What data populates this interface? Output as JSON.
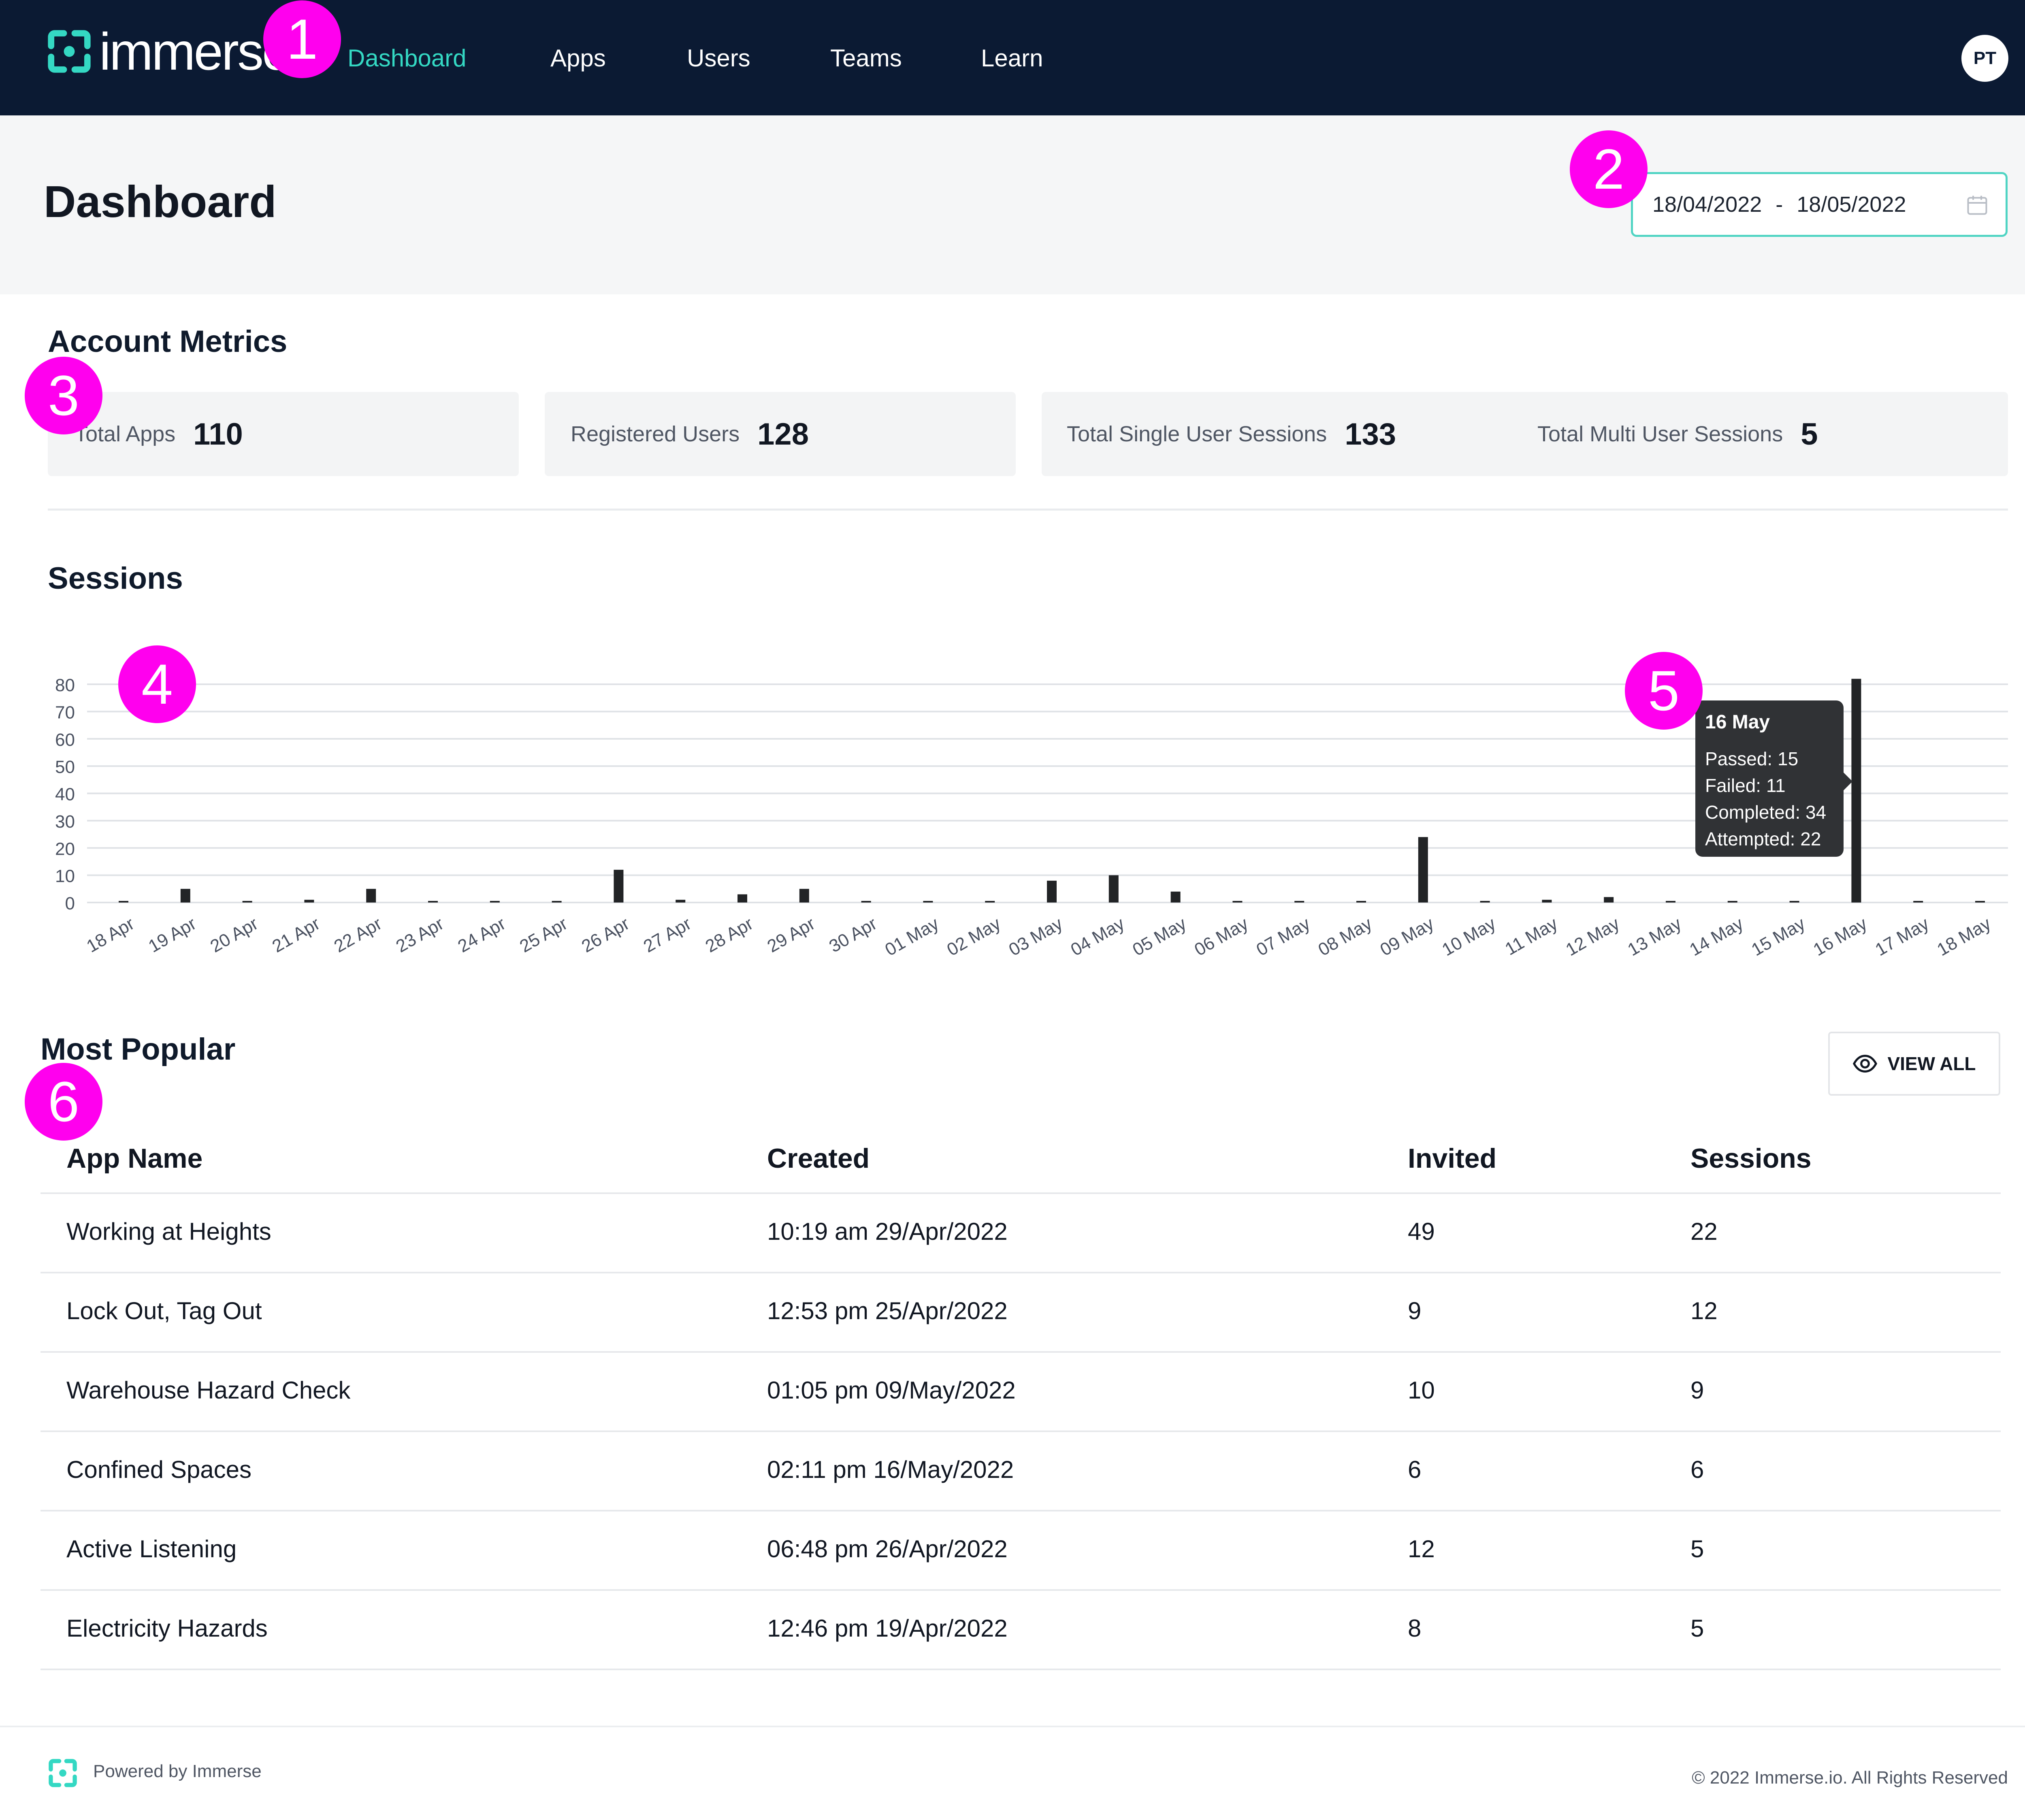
{
  "app": {
    "brand": "immerse"
  },
  "nav": {
    "items": [
      "Dashboard",
      "Apps",
      "Users",
      "Teams",
      "Learn"
    ],
    "active": "Dashboard",
    "avatar_initials": "PT"
  },
  "page": {
    "title": "Dashboard",
    "date_start": "18/04/2022",
    "date_sep": "-",
    "date_end": "18/05/2022"
  },
  "metrics": {
    "title": "Account Metrics",
    "total_apps_label": "Total Apps",
    "total_apps": "110",
    "registered_users_label": "Registered Users",
    "registered_users": "128",
    "single_sessions_label": "Total Single User Sessions",
    "single_sessions": "133",
    "multi_sessions_label": "Total Multi User Sessions",
    "multi_sessions": "5"
  },
  "sessions": {
    "title": "Sessions"
  },
  "chart_data": {
    "type": "bar",
    "title": "Sessions",
    "categories": [
      "18 Apr",
      "19 Apr",
      "20 Apr",
      "21 Apr",
      "22 Apr",
      "23 Apr",
      "24 Apr",
      "25 Apr",
      "26 Apr",
      "27 Apr",
      "28 Apr",
      "29 Apr",
      "30 Apr",
      "01 May",
      "02 May",
      "03 May",
      "04 May",
      "05 May",
      "06 May",
      "07 May",
      "08 May",
      "09 May",
      "10 May",
      "11 May",
      "12 May",
      "13 May",
      "14 May",
      "15 May",
      "16 May",
      "17 May",
      "18 May"
    ],
    "values": [
      0,
      5,
      0,
      1,
      5,
      0,
      0,
      0,
      12,
      1,
      3,
      5,
      0,
      0,
      0,
      8,
      10,
      4,
      0,
      0,
      0,
      24,
      0,
      1,
      2,
      0,
      0,
      0,
      82,
      0,
      0
    ],
    "ylim": [
      0,
      80
    ],
    "yticks": [
      0,
      10,
      20,
      30,
      40,
      50,
      60,
      70,
      80
    ],
    "grid": true,
    "bar_color": "#222426",
    "tooltip": {
      "date": "16 May",
      "lines": [
        "Passed: 15",
        "Failed: 11",
        "Completed: 34",
        "Attempted: 22"
      ]
    }
  },
  "popular": {
    "title": "Most Popular",
    "view_all": "VIEW ALL",
    "columns": [
      "App Name",
      "Created",
      "Invited",
      "Sessions"
    ],
    "rows": [
      [
        "Working at Heights",
        "10:19 am 29/Apr/2022",
        "49",
        "22"
      ],
      [
        "Lock Out, Tag Out",
        "12:53 pm 25/Apr/2022",
        "9",
        "12"
      ],
      [
        "Warehouse Hazard Check",
        "01:05 pm 09/May/2022",
        "10",
        "9"
      ],
      [
        "Confined Spaces",
        "02:11 pm 16/May/2022",
        "6",
        "6"
      ],
      [
        "Active Listening",
        "06:48 pm 26/Apr/2022",
        "12",
        "5"
      ],
      [
        "Electricity Hazards",
        "12:46 pm 19/Apr/2022",
        "8",
        "5"
      ]
    ]
  },
  "footer": {
    "powered": "Powered by Immerse",
    "copyright": "© 2022 Immerse.io. All Rights Reserved"
  },
  "markers": [
    "1",
    "2",
    "3",
    "4",
    "5",
    "6"
  ],
  "colors": {
    "navbar": "#0b1a33",
    "accent": "#34d8c3",
    "marker": "#ff00ee"
  }
}
